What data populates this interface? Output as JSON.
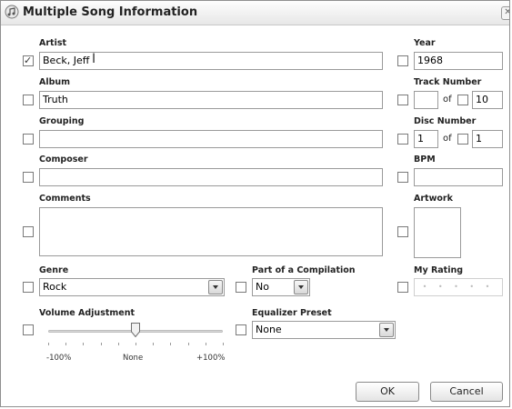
{
  "window": {
    "title": "Multiple Song Information"
  },
  "fields": {
    "artist": {
      "label": "Artist",
      "value": "Beck, Jeff",
      "checked": true
    },
    "album": {
      "label": "Album",
      "value": "Truth",
      "checked": false
    },
    "grouping": {
      "label": "Grouping",
      "value": "",
      "checked": false
    },
    "composer": {
      "label": "Composer",
      "value": "",
      "checked": false
    },
    "comments": {
      "label": "Comments",
      "value": "",
      "checked": false
    },
    "year": {
      "label": "Year",
      "value": "1968",
      "checked": false
    },
    "track_number": {
      "label": "Track Number",
      "value": "",
      "of_label": "of",
      "total": "10"
    },
    "disc_number": {
      "label": "Disc Number",
      "value": "1",
      "of_label": "of",
      "total": "1"
    },
    "bpm": {
      "label": "BPM",
      "value": ""
    },
    "artwork": {
      "label": "Artwork"
    },
    "genre": {
      "label": "Genre",
      "value": "Rock"
    },
    "compilation": {
      "label": "Part of a Compilation",
      "value": "No"
    },
    "my_rating": {
      "label": "My Rating"
    },
    "volume": {
      "label": "Volume Adjustment",
      "min_label": "-100%",
      "mid_label": "None",
      "max_label": "+100%",
      "value_percent": 0
    },
    "equalizer": {
      "label": "Equalizer Preset",
      "value": "None"
    }
  },
  "buttons": {
    "ok": "OK",
    "cancel": "Cancel"
  },
  "icons": {
    "app": "itunes-icon",
    "close": "close-icon"
  }
}
